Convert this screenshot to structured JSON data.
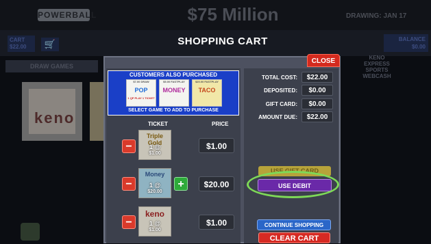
{
  "background": {
    "logo": "POWERBALL",
    "jackpot": "$75 Million",
    "drawing": "DRAWING: JAN 17",
    "cart_label": "CART",
    "cart_amount": "$22.00",
    "balance_label": "BALANCE",
    "balance_amount": "$0.00",
    "nav_label": "DRAW GAMES",
    "side_label_line1": "KENO",
    "side_label_line2": "EXPRESS SPORTS",
    "side_label_line3": "WEBCASH",
    "tile_label": "keno"
  },
  "dialog": {
    "title": "SHOPPING CART",
    "close_label": "CLOSE"
  },
  "promo": {
    "title": "CUSTOMERS ALSO PURCHASED",
    "subtitle": "SELECT GAME TO ADD TO PURCHASE",
    "items": [
      {
        "caption": "$7.00 DRAW",
        "name": "POP",
        "badge": "1 QP PLAY 1 TICKET"
      },
      {
        "caption": "$5.00 FASTPLAY",
        "name": "MONEY",
        "badge": ""
      },
      {
        "caption": "$20.00 FASTPLAY",
        "name": "TACO",
        "badge": ""
      }
    ]
  },
  "columns": {
    "ticket": "TICKET",
    "price": "PRICE"
  },
  "items": [
    {
      "name": "Triple Gold",
      "qty": "1 @",
      "unit": "$1.00",
      "price": "$1.00"
    },
    {
      "name": "Money",
      "qty": "1 @",
      "unit": "$20.00",
      "price": "$20.00"
    },
    {
      "name": "keno",
      "qty": "1 @",
      "unit": "$1.00",
      "price": "$1.00"
    }
  ],
  "summary": {
    "total_cost_label": "TOTAL COST:",
    "total_cost": "$22.00",
    "deposited_label": "DEPOSITED:",
    "deposited": "$0.00",
    "gift_card_label": "GIFT CARD:",
    "gift_card": "$0.00",
    "amount_due_label": "AMOUNT DUE:",
    "amount_due": "$22.00"
  },
  "buttons": {
    "gift_card": "USE GIFT CARD",
    "debit": "USE DEBIT",
    "continue": "CONTINUE SHOPPING",
    "clear": "CLEAR CART"
  },
  "colors": {
    "highlight_ring": "#7ed957",
    "debit_button": "#6a29a8",
    "close_button": "#d42a1e",
    "promo_panel": "#1a3fc7"
  }
}
